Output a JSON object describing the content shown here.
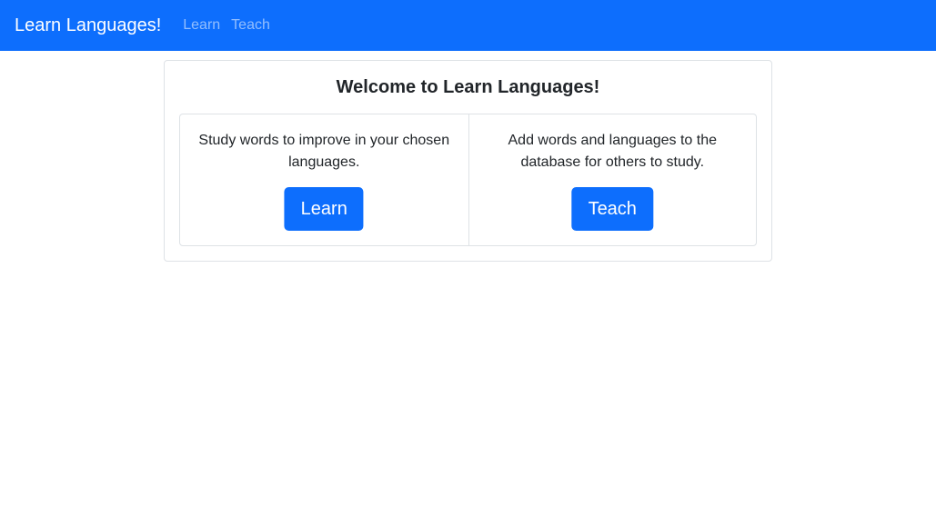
{
  "navbar": {
    "brand": "Learn Languages!",
    "links": [
      "Learn",
      "Teach"
    ]
  },
  "main": {
    "title": "Welcome to Learn Languages!",
    "learn": {
      "description": "Study words to improve in your chosen languages.",
      "button_label": "Learn"
    },
    "teach": {
      "description": "Add words and languages to the database for others to study.",
      "button_label": "Teach"
    }
  },
  "colors": {
    "primary": "#0d6efd",
    "border": "#dee2e6",
    "text": "#212529"
  }
}
